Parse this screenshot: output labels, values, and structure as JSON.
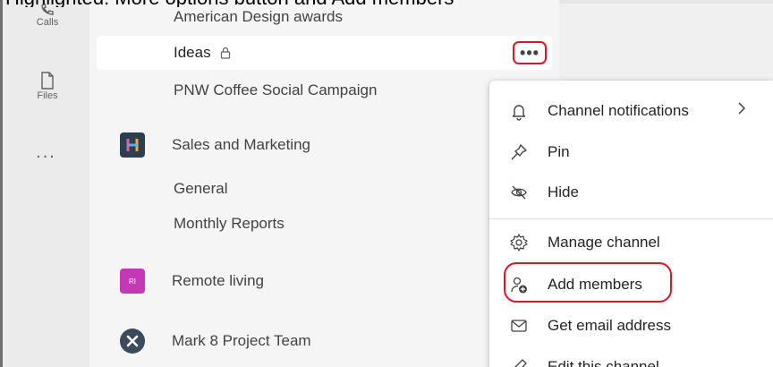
{
  "caption": "Highlighted: More options button and Add members",
  "rail": {
    "calls_label": "Calls",
    "files_label": "Files",
    "more_label": "..."
  },
  "channel_list": {
    "items": [
      {
        "kind": "channel",
        "label": "American Design awards"
      },
      {
        "kind": "channel",
        "label": "Ideas",
        "selected": true,
        "private": true
      },
      {
        "kind": "channel",
        "label": "PNW Coffee Social Campaign"
      },
      {
        "kind": "team",
        "label": "Sales and Marketing",
        "avatar": "H"
      },
      {
        "kind": "channel",
        "label": "General"
      },
      {
        "kind": "channel",
        "label": "Monthly Reports"
      },
      {
        "kind": "team",
        "label": "Remote living",
        "avatar": "RI"
      },
      {
        "kind": "team",
        "label": "Mark 8 Project Team",
        "avatar": "x-icon"
      }
    ],
    "more_options_label": "•••"
  },
  "context_menu": {
    "items": [
      {
        "label": "Channel notifications",
        "icon": "bell-icon",
        "submenu": true
      },
      {
        "label": "Pin",
        "icon": "pin-icon"
      },
      {
        "label": "Hide",
        "icon": "eye-off-icon"
      },
      {
        "label": "Manage channel",
        "icon": "gear-icon"
      },
      {
        "label": "Add members",
        "icon": "add-person-icon",
        "highlighted": true
      },
      {
        "label": "Get email address",
        "icon": "mail-icon"
      },
      {
        "label": "Edit this channel",
        "icon": "edit-icon"
      }
    ]
  },
  "colors": {
    "highlight": "#e81123",
    "rail_bg": "#ebebeb",
    "list_bg": "#f5f5f5",
    "sales_avatar": "#2c3e50",
    "remote_avatar": "#c239b3"
  }
}
